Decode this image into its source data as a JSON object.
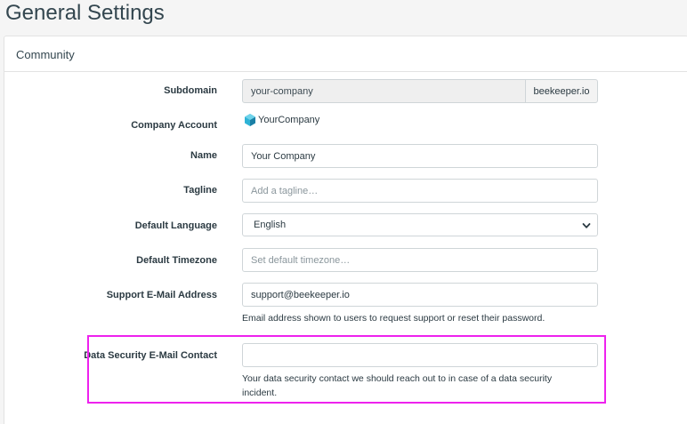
{
  "page": {
    "title": "General Settings"
  },
  "panel": {
    "title": "Community"
  },
  "form": {
    "subdomain": {
      "label": "Subdomain",
      "value": "your-company",
      "suffix": "beekeeper.io"
    },
    "company_account": {
      "label": "Company Account",
      "value": "YourCompany",
      "icon": "company-logo-icon"
    },
    "name": {
      "label": "Name",
      "value": "Your Company"
    },
    "tagline": {
      "label": "Tagline",
      "value": "",
      "placeholder": "Add a tagline…"
    },
    "default_language": {
      "label": "Default Language",
      "value": "English"
    },
    "default_timezone": {
      "label": "Default Timezone",
      "value": "",
      "placeholder": "Set default timezone…"
    },
    "support_email": {
      "label": "Support E-Mail Address",
      "value": "support@beekeeper.io",
      "help": "Email address shown to users to request support or reset their password."
    },
    "data_security_email": {
      "label": "Data Security E-Mail Contact",
      "value": "",
      "help": "Your data security contact we should reach out to in case of a data security incident."
    }
  },
  "colors": {
    "highlight": "#ee22ee",
    "logo_primary": "#2fb3d6",
    "logo_secondary": "#1b7fa5"
  }
}
